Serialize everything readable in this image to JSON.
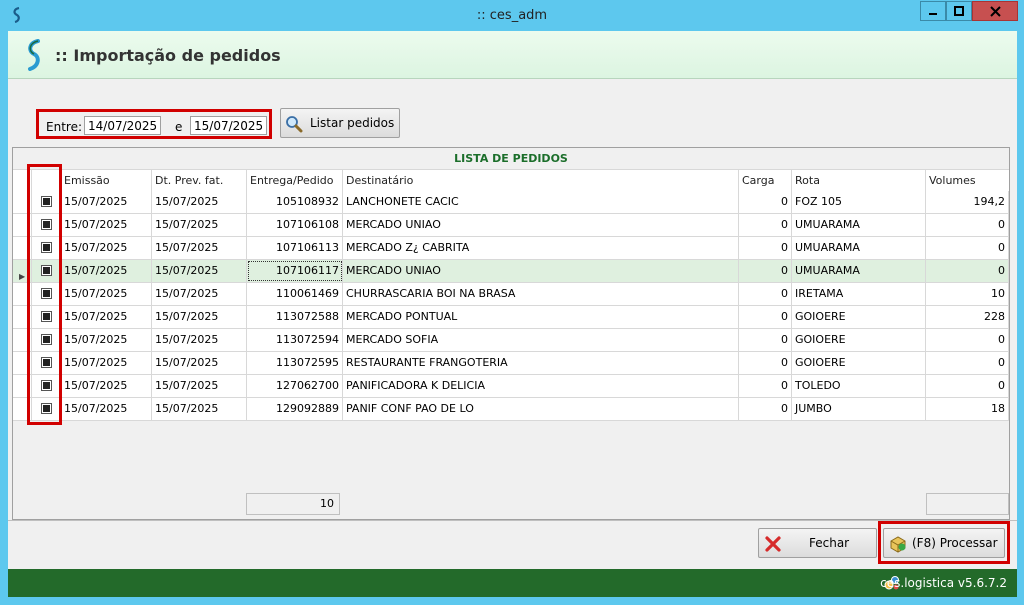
{
  "window": {
    "title": ":: ces_adm",
    "controls": [
      "minimize-icon",
      "maximize-icon",
      "close-icon"
    ]
  },
  "header": {
    "title": ":: Importação de pedidos",
    "logo_icon": "ces-logo-icon"
  },
  "filter": {
    "label_from": "Entre:",
    "date_from": "14/07/2025",
    "label_and": "e",
    "date_to": "15/07/2025",
    "list_button": "Listar pedidos",
    "list_icon": "magnifier-icon"
  },
  "grid": {
    "title": "LISTA DE PEDIDOS",
    "columns": [
      "",
      "",
      "Emissão",
      "Dt. Prev. fat.",
      "Entrega/Pedido",
      "Destinatário",
      "Carga",
      "Rota",
      "Volumes"
    ],
    "rows": [
      {
        "checked": true,
        "emissao": "15/07/2025",
        "prev": "15/07/2025",
        "pedido": "105108932",
        "dest": "LANCHONETE CACIC",
        "carga": "0",
        "rota": "FOZ 105",
        "volumes": "194,2"
      },
      {
        "checked": true,
        "emissao": "15/07/2025",
        "prev": "15/07/2025",
        "pedido": "107106108",
        "dest": "MERCADO UNIAO",
        "carga": "0",
        "rota": "UMUARAMA",
        "volumes": "0"
      },
      {
        "checked": true,
        "emissao": "15/07/2025",
        "prev": "15/07/2025",
        "pedido": "107106113",
        "dest": "MERCADO Z¿ CABRITA",
        "carga": "0",
        "rota": "UMUARAMA",
        "volumes": "0"
      },
      {
        "checked": true,
        "emissao": "15/07/2025",
        "prev": "15/07/2025",
        "pedido": "107106117",
        "dest": "MERCADO UNIAO",
        "carga": "0",
        "rota": "UMUARAMA",
        "volumes": "0"
      },
      {
        "checked": true,
        "emissao": "15/07/2025",
        "prev": "15/07/2025",
        "pedido": "110061469",
        "dest": "CHURRASCARIA BOI NA BRASA",
        "carga": "0",
        "rota": "IRETAMA",
        "volumes": "10"
      },
      {
        "checked": true,
        "emissao": "15/07/2025",
        "prev": "15/07/2025",
        "pedido": "113072588",
        "dest": "MERCADO PONTUAL",
        "carga": "0",
        "rota": "GOIOERE",
        "volumes": "228"
      },
      {
        "checked": true,
        "emissao": "15/07/2025",
        "prev": "15/07/2025",
        "pedido": "113072594",
        "dest": "MERCADO SOFIA",
        "carga": "0",
        "rota": "GOIOERE",
        "volumes": "0"
      },
      {
        "checked": true,
        "emissao": "15/07/2025",
        "prev": "15/07/2025",
        "pedido": "113072595",
        "dest": "RESTAURANTE FRANGOTERIA",
        "carga": "0",
        "rota": "GOIOERE",
        "volumes": "0"
      },
      {
        "checked": true,
        "emissao": "15/07/2025",
        "prev": "15/07/2025",
        "pedido": "127062700",
        "dest": "PANIFICADORA K DELICIA",
        "carga": "0",
        "rota": "TOLEDO",
        "volumes": "0"
      },
      {
        "checked": true,
        "emissao": "15/07/2025",
        "prev": "15/07/2025",
        "pedido": "129092889",
        "dest": "PANIF CONF PAO DE LO",
        "carga": "0",
        "rota": "JUMBO",
        "volumes": "18"
      }
    ],
    "total_count": "10",
    "total_volumes": ""
  },
  "actions": {
    "close_label": "Fechar",
    "close_icon": "red-x-icon",
    "process_label": "(F8) Processar",
    "process_icon": "process-box-icon"
  },
  "status": {
    "version": "ces.logistica v5.6.7.2",
    "icon": "gears-icon"
  },
  "colors": {
    "titlebar": "#5dc8ee",
    "header_bg": "#e3f7e6",
    "grid_title": "#1b6e2a",
    "statusbar": "#236a2a",
    "highlight": "#d10000",
    "selected_row": "#dff0df"
  }
}
